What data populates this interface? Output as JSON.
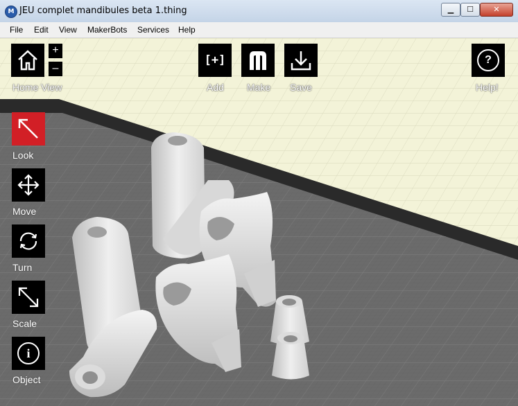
{
  "window": {
    "title": "JEU complet mandibules beta 1.thing",
    "icon": "makerbot-app-icon",
    "controls": {
      "minimize": "▁",
      "maximize": "☐",
      "close": "✕"
    }
  },
  "menu": [
    "File",
    "Edit",
    "View",
    "MakerBots",
    "Services",
    "Help"
  ],
  "top_toolbar": {
    "home": {
      "label": "Home View",
      "icon": "home-icon"
    },
    "zoom_in": "+",
    "zoom_out": "–",
    "add": {
      "label": "Add",
      "glyph": "[+]",
      "icon": "add-icon"
    },
    "make": {
      "label": "Make",
      "icon": "makerbot-m-icon"
    },
    "save": {
      "label": "Save",
      "icon": "download-icon"
    },
    "help": {
      "label": "Help!",
      "glyph": "?",
      "icon": "help-icon"
    }
  },
  "side_tools": [
    {
      "label": "Look",
      "icon": "look-arrow-icon",
      "active": true
    },
    {
      "label": "Move",
      "icon": "move-arrows-icon",
      "active": false
    },
    {
      "label": "Turn",
      "icon": "rotate-icon",
      "active": false
    },
    {
      "label": "Scale",
      "icon": "scale-icon",
      "active": false
    },
    {
      "label": "Object",
      "icon": "info-icon",
      "active": false
    }
  ],
  "colors": {
    "active_tool": "#d21f26",
    "tool_bg": "#000000",
    "build_plate": "#6b6b6b",
    "background_grid": "#f3f3d8",
    "model": "#e8e8e8"
  }
}
